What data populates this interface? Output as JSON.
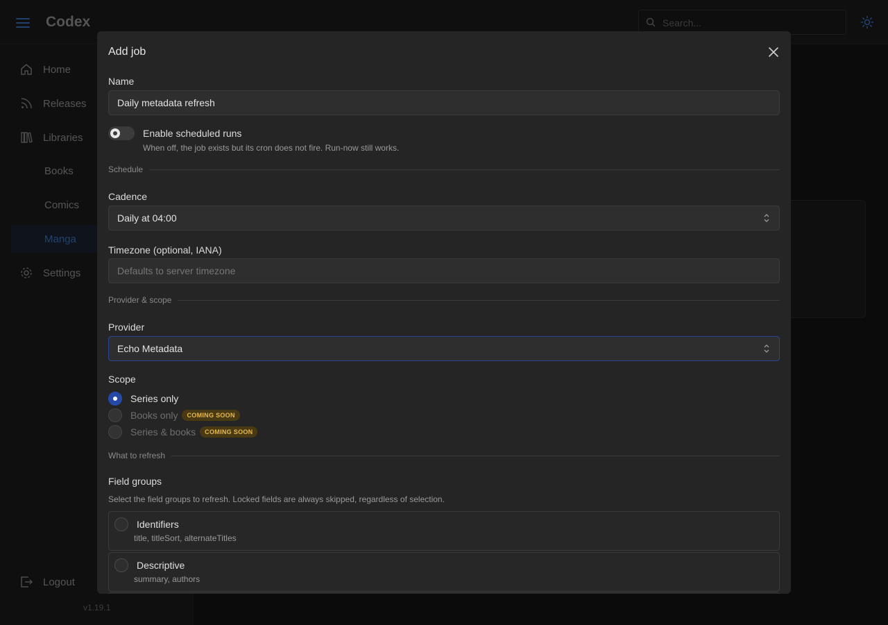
{
  "app": {
    "brand": "Codex",
    "version": "v1.19.1"
  },
  "search": {
    "placeholder": "Search..."
  },
  "sidebar": {
    "items": [
      {
        "label": "Home"
      },
      {
        "label": "Releases"
      },
      {
        "label": "Libraries"
      },
      {
        "label": "Books"
      },
      {
        "label": "Comics"
      },
      {
        "label": "Manga"
      },
      {
        "label": "Settings"
      }
    ],
    "logout": "Logout"
  },
  "colors": {
    "accent": "#3d78c6",
    "radio_on": "#2649a8",
    "badge_bg": "#4a3a14",
    "badge_text": "#e6b850"
  },
  "modal": {
    "title": "Add job",
    "name": {
      "label": "Name",
      "value": "Daily metadata refresh"
    },
    "toggle": {
      "label": "Enable scheduled runs",
      "desc": "When off, the job exists but its cron does not fire. Run-now still works.",
      "on": false
    },
    "sections": {
      "schedule": "Schedule",
      "provider_scope": "Provider & scope",
      "what": "What to refresh"
    },
    "cadence": {
      "label": "Cadence",
      "value": "Daily at 04:00"
    },
    "timezone": {
      "label": "Timezone (optional, IANA)",
      "placeholder": "Defaults to server timezone"
    },
    "provider": {
      "label": "Provider",
      "value": "Echo Metadata"
    },
    "scope": {
      "label": "Scope",
      "options": [
        {
          "label": "Series only",
          "selected": true,
          "badge": ""
        },
        {
          "label": "Books only",
          "selected": false,
          "badge": "COMING SOON"
        },
        {
          "label": "Series & books",
          "selected": false,
          "badge": "COMING SOON"
        }
      ]
    },
    "field_groups": {
      "label": "Field groups",
      "helper": "Select the field groups to refresh. Locked fields are always skipped, regardless of selection.",
      "items": [
        {
          "title": "Identifiers",
          "desc": "title, titleSort, alternateTitles"
        },
        {
          "title": "Descriptive",
          "desc": "summary, authors"
        }
      ]
    }
  }
}
